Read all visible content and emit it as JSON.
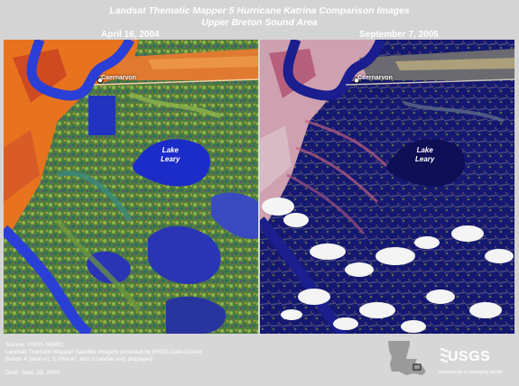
{
  "header": {
    "title_line1": "Landsat Thematic Mapper 5  Hurricane Katrina Comparison Images",
    "title_line2": "Upper Breton Sound Area"
  },
  "panels": {
    "left_date": "April  16, 2004",
    "right_date": "September 7, 2005",
    "place_label": "Caernarvon",
    "lake_label_line1": "Lake",
    "lake_label_line2": "Leary"
  },
  "footer": {
    "line1": "Source: USGS NWRC",
    "line2": "Landsat Thematic Mapper Satellite Imagery provided by EROS Data Center",
    "line3": "Bands 4 (near-ir), 5 (mid-ir), and  3 (visible red) displayed",
    "line4": "Draft: Sept. 28, 2005"
  },
  "logo": {
    "wordmark": "USGS",
    "tagline": "science for a changing world"
  },
  "colors": {
    "frame_bg": "#d4d4d4",
    "water": "#1c2cc8",
    "river": "#2a3fd6",
    "land_orange": "#e8731f",
    "land_red": "#c84020",
    "marsh_green": "#6f9a3a",
    "marsh_teal": "#3c8a7a",
    "post_water": "#14137a",
    "cloud": "#f4f4f4"
  }
}
